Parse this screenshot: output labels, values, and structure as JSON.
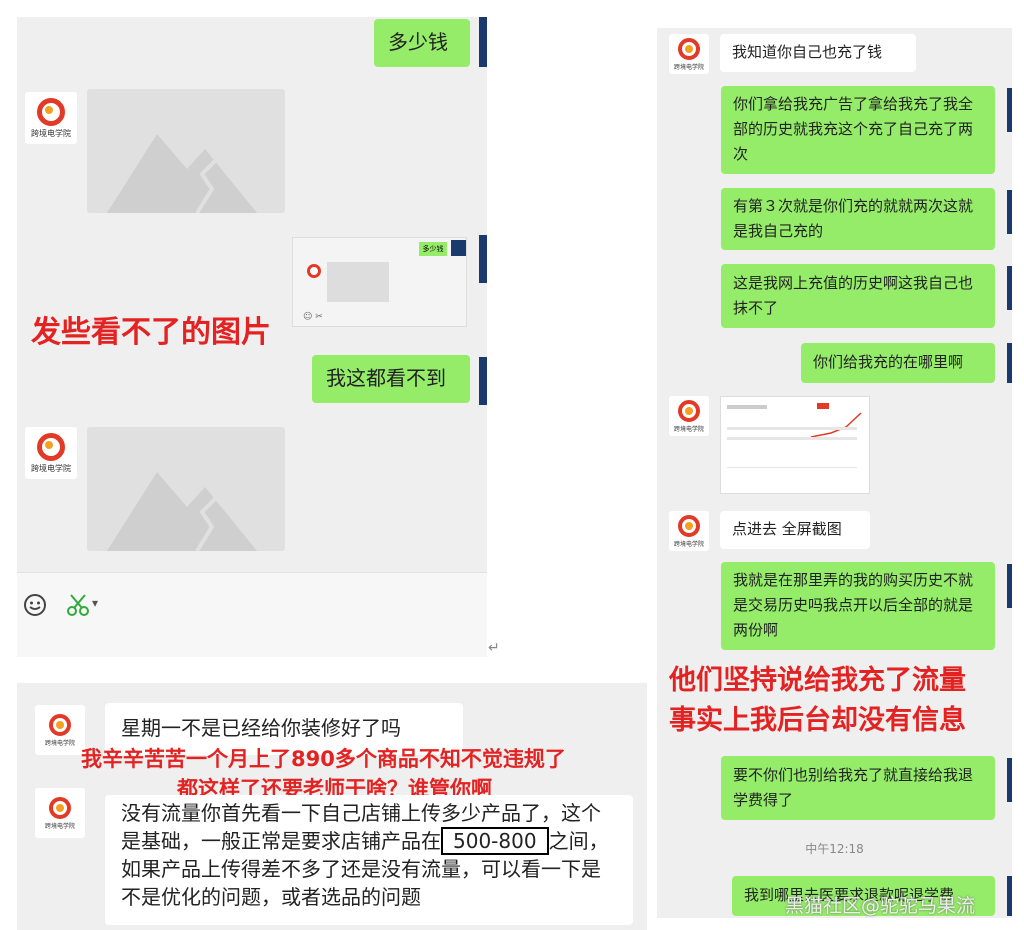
{
  "avatar_text": "跨境电学院",
  "colors": {
    "me_bubble": "#95ec69",
    "them_bubble": "#ffffff",
    "annotation": "#e32222"
  },
  "panel_a": {
    "msg_me_1": "多少钱",
    "thumb_msg": "多少钱",
    "msg_me_2": "我这都看不到",
    "annotation": "发些看不了的图片",
    "toolbar": {
      "emoji_icon": "smile-face-icon",
      "scissors_icon": "scissors-icon",
      "dropdown": "▾"
    }
  },
  "enter_glyph": "↵",
  "panel_b": {
    "msg_them_1": "星期一不是已经给你装修好了吗",
    "annotation_line1": "我辛辛苦苦一个月上了890多个商品不知不觉违规了",
    "annotation_line2": "都这样了还要老师干啥？谁管你啊",
    "msg_them_2_part1": "没有流量你首先看一下自己店铺上传多少产品了，这个是基础，一般正常是要求店铺产品在",
    "msg_them_2_highlight": "500-800",
    "msg_them_2_part2": "之间，如果产品上传得差不多了还是没有流量，可以看一下是不是优化的问题，或者选品的问题"
  },
  "panel_c": {
    "msg_them_1": "我知道你自己也充了钱",
    "msg_me_1": "你们拿给我充广告了拿给我充了我全部的历史就我充这个充了自己充了两次",
    "msg_me_2": "有第３次就是你们充的就就两次这就是我自己充的",
    "msg_me_3": "这是我网上充值的历史啊这我自己也抹不了",
    "msg_me_4": "你们给我充的在哪里啊",
    "msg_them_2": "点进去 全屏截图",
    "msg_me_5": "我就是在那里弄的我的购买历史不就是交易历史吗我点开以后全部的就是两份啊",
    "annotation_line1": "他们坚持说给我充了流量",
    "annotation_line2": "事实上我后台却没有信息",
    "msg_me_6": "要不你们也别给我充了就直接给我退学费得了",
    "timestamp": "中午12:18",
    "msg_me_7": "我到哪里去医要求退款呢退学费",
    "watermark": "黑猫社区@驼驼马果流"
  }
}
